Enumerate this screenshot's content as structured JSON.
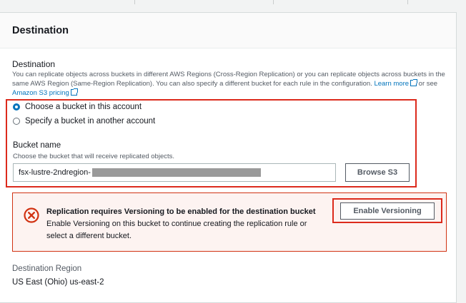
{
  "panel": {
    "title": "Destination"
  },
  "destination": {
    "label": "Destination",
    "description": "You can replicate objects across buckets in different AWS Regions (Cross-Region Replication) or you can replicate objects across buckets in the same AWS Region (Same-Region Replication). You can also specify a different bucket for each rule in the configuration.",
    "learn_more_link": "Learn more",
    "or_see": "or see",
    "pricing_link": "Amazon S3 pricing",
    "options": [
      {
        "label": "Choose a bucket in this account",
        "selected": true
      },
      {
        "label": "Specify a bucket in another account",
        "selected": false
      }
    ]
  },
  "bucket": {
    "label": "Bucket name",
    "description": "Choose the bucket that will receive replicated objects.",
    "value_visible": "fsx-lustre-2ndregion-",
    "browse_label": "Browse S3"
  },
  "alert": {
    "title": "Replication requires Versioning to be enabled for the destination bucket",
    "body": "Enable Versioning on this bucket to continue creating the replication rule or select a different bucket.",
    "button_label": "Enable Versioning",
    "icon": "error-x-icon"
  },
  "region": {
    "label": "Destination Region",
    "value": "US East (Ohio) us-east-2"
  },
  "colors": {
    "accent": "#0073bb",
    "error": "#d13212",
    "highlight": "#dc2a1c",
    "alert_bg": "#fdf3f1"
  }
}
